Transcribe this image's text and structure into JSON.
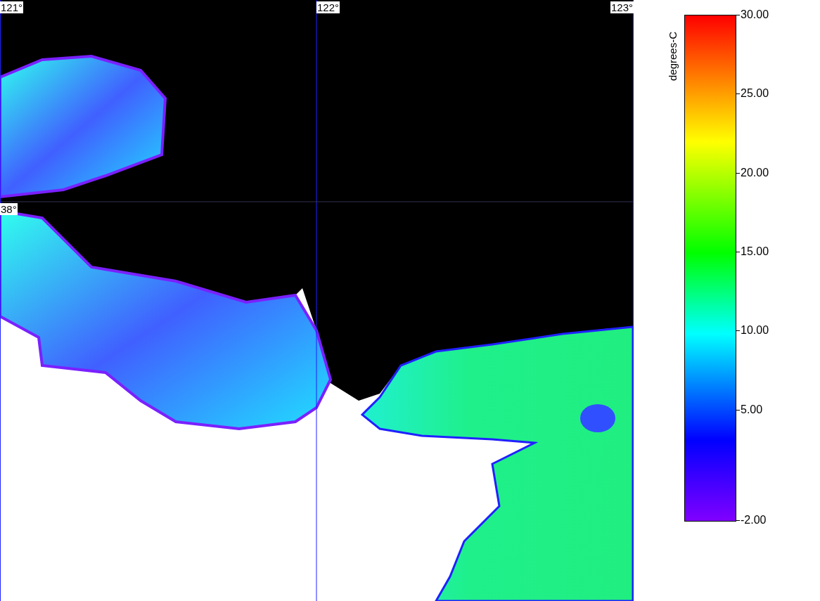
{
  "map": {
    "lon_labels": [
      "121°",
      "122°",
      "123°"
    ],
    "lat_labels": [
      "38°"
    ]
  },
  "colorbar": {
    "unit": "degrees-C",
    "ticks": [
      "30.00",
      "25.00",
      "20.00",
      "15.00",
      "10.00",
      "5.00",
      "-2.00"
    ]
  }
}
